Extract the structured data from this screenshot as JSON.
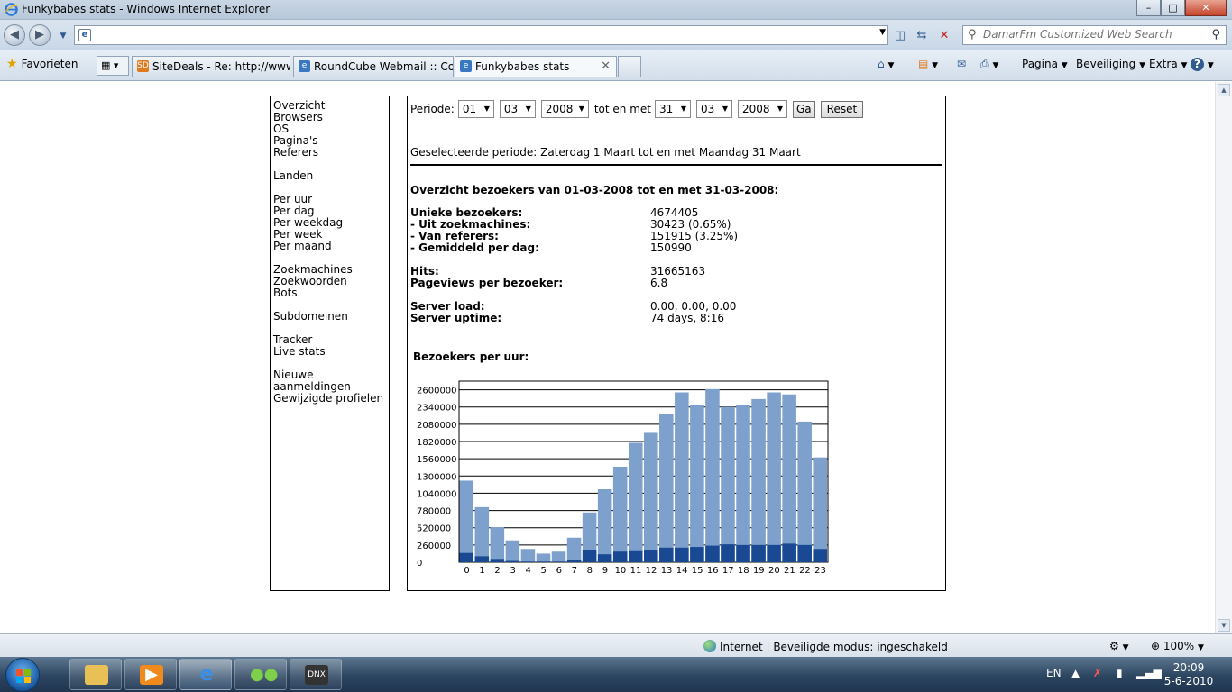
{
  "window": {
    "title": "Funkybabes stats - Windows Internet Explorer",
    "minimize": "–",
    "maximize": "□",
    "close": "✕"
  },
  "address": {
    "url": "",
    "search_placeholder": "DamarFm Customized Web Search"
  },
  "tabs": {
    "favorites_label": "Favorieten",
    "items": [
      {
        "label": "SiteDeals - Re: http://www....",
        "icon_color": "#e07a1f",
        "icon_text": "SD"
      },
      {
        "label": "RoundCube Webmail :: Co...",
        "icon_color": "#3a78c2",
        "icon_text": "e"
      },
      {
        "label": "Funkybabes stats",
        "icon_color": "#3a78c2",
        "icon_text": "e"
      }
    ],
    "commands": {
      "page": "Pagina",
      "security": "Beveiliging",
      "extra": "Extra"
    }
  },
  "sidebar": {
    "groups": [
      [
        "Overzicht",
        "Browsers",
        "OS",
        "Pagina's",
        "Referers"
      ],
      [
        "Landen"
      ],
      [
        "Per uur",
        "Per dag",
        "Per weekdag",
        "Per week",
        "Per maand"
      ],
      [
        "Zoekmachines",
        "Zoekwoorden",
        "Bots"
      ],
      [
        "Subdomeinen"
      ],
      [
        "Tracker",
        "Live stats"
      ],
      [
        "Nieuwe aanmeldingen",
        "Gewijzigde profielen"
      ]
    ]
  },
  "period": {
    "label": "Periode:",
    "from_day": "01",
    "from_month": "03",
    "from_year": "2008",
    "until_label": "tot en met",
    "to_day": "31",
    "to_month": "03",
    "to_year": "2008",
    "go_button": "Ga",
    "reset_button": "Reset",
    "selected_text": "Geselecteerde periode: Zaterdag 1 Maart tot en met Maandag 31 Maart"
  },
  "overview": {
    "title": "Overzicht bezoekers van 01-03-2008 tot en met 31-03-2008:",
    "groups": [
      [
        {
          "label": "Unieke bezoekers:",
          "value": "4674405"
        },
        {
          "label": "- Uit zoekmachines:",
          "value": "30423 (0.65%)"
        },
        {
          "label": "- Van referers:",
          "value": "151915 (3.25%)"
        },
        {
          "label": "- Gemiddeld per dag:",
          "value": "150990"
        }
      ],
      [
        {
          "label": "Hits:",
          "value": "31665163"
        },
        {
          "label": "Pageviews per bezoeker:",
          "value": "6.8"
        }
      ],
      [
        {
          "label": "Server load:",
          "value": "0.00, 0.00, 0.00"
        },
        {
          "label": "Server uptime:",
          "value": "74 days, 8:16"
        }
      ]
    ]
  },
  "chart_title": "Bezoekers per uur:",
  "chart_data": {
    "type": "bar",
    "title": "Bezoekers per uur:",
    "categories": [
      "0",
      "1",
      "2",
      "3",
      "4",
      "5",
      "6",
      "7",
      "8",
      "9",
      "10",
      "11",
      "12",
      "13",
      "14",
      "15",
      "16",
      "17",
      "18",
      "19",
      "20",
      "21",
      "22",
      "23"
    ],
    "series": [
      {
        "values": [
          1230000,
          830000,
          530000,
          330000,
          200000,
          130000,
          160000,
          370000,
          750000,
          1100000,
          1440000,
          1800000,
          1950000,
          2230000,
          2560000,
          2370000,
          2610000,
          2340000,
          2370000,
          2460000,
          2560000,
          2530000,
          2120000,
          1580000
        ],
        "color": "#7da1cc"
      },
      {
        "values": [
          140000,
          90000,
          50000,
          20000,
          10000,
          10000,
          10000,
          30000,
          190000,
          120000,
          160000,
          180000,
          190000,
          220000,
          220000,
          230000,
          250000,
          270000,
          260000,
          260000,
          260000,
          280000,
          260000,
          200000
        ],
        "color": "#1a4994"
      }
    ],
    "stacked": false,
    "ylim": [
      0,
      2730000
    ],
    "yticks": [
      0,
      260000,
      520000,
      780000,
      1040000,
      1300000,
      1560000,
      1820000,
      2080000,
      2340000,
      2600000
    ],
    "ytick_labels": [
      "0",
      "260000",
      "520000",
      "780000",
      "1040000",
      "1300000",
      "1560000",
      "1820000",
      "2080000",
      "2340000",
      "2600000"
    ],
    "grid": true
  },
  "statusbar": {
    "zone": "Internet | Beveiligde modus: ingeschakeld",
    "zoom": "100%"
  },
  "taskbar": {
    "language": "EN",
    "time": "20:09",
    "date": "5-6-2010"
  }
}
